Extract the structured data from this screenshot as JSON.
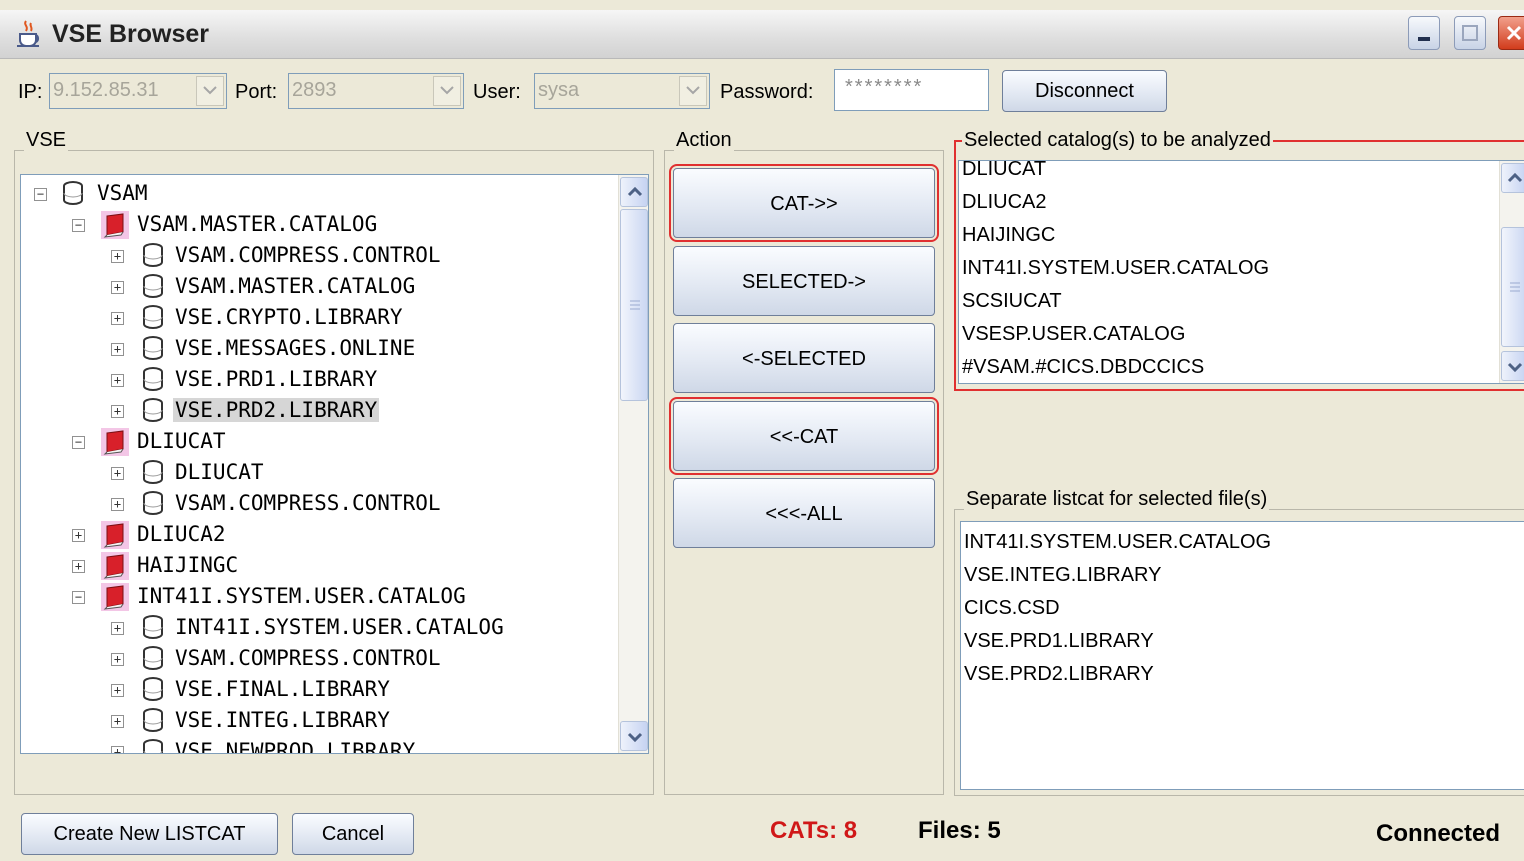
{
  "window": {
    "title": "VSE Browser"
  },
  "connection": {
    "ip_label": "IP:",
    "ip_value": "9.152.85.31",
    "port_label": "Port:",
    "port_value": "2893",
    "user_label": "User:",
    "user_value": "sysa",
    "password_label": "Password:",
    "password_value": "********",
    "disconnect_label": "Disconnect"
  },
  "vse": {
    "title": "VSE",
    "tree": [
      {
        "label": "VSAM",
        "level": 0,
        "expander": "−",
        "icon": "database-icon"
      },
      {
        "label": "VSAM.MASTER.CATALOG",
        "level": 1,
        "expander": "−",
        "icon": "catalog-book-icon"
      },
      {
        "label": "VSAM.COMPRESS.CONTROL",
        "level": 2,
        "expander": "+",
        "icon": "database-icon"
      },
      {
        "label": "VSAM.MASTER.CATALOG",
        "level": 2,
        "expander": "+",
        "icon": "database-icon"
      },
      {
        "label": "VSE.CRYPTO.LIBRARY",
        "level": 2,
        "expander": "+",
        "icon": "database-icon"
      },
      {
        "label": "VSE.MESSAGES.ONLINE",
        "level": 2,
        "expander": "+",
        "icon": "database-icon"
      },
      {
        "label": "VSE.PRD1.LIBRARY",
        "level": 2,
        "expander": "+",
        "icon": "database-icon"
      },
      {
        "label": "VSE.PRD2.LIBRARY",
        "level": 2,
        "expander": "+",
        "icon": "database-icon",
        "selected": true
      },
      {
        "label": "DLIUCAT",
        "level": 1,
        "expander": "−",
        "icon": "catalog-book-icon"
      },
      {
        "label": "DLIUCAT",
        "level": 2,
        "expander": "+",
        "icon": "database-icon"
      },
      {
        "label": "VSAM.COMPRESS.CONTROL",
        "level": 2,
        "expander": "+",
        "icon": "database-icon"
      },
      {
        "label": "DLIUCA2",
        "level": 1,
        "expander": "+",
        "icon": "catalog-book-icon"
      },
      {
        "label": "HAIJINGC",
        "level": 1,
        "expander": "+",
        "icon": "catalog-book-icon"
      },
      {
        "label": "INT41I.SYSTEM.USER.CATALOG",
        "level": 1,
        "expander": "−",
        "icon": "catalog-book-icon"
      },
      {
        "label": "INT41I.SYSTEM.USER.CATALOG",
        "level": 2,
        "expander": "+",
        "icon": "database-icon"
      },
      {
        "label": "VSAM.COMPRESS.CONTROL",
        "level": 2,
        "expander": "+",
        "icon": "database-icon"
      },
      {
        "label": "VSE.FINAL.LIBRARY",
        "level": 2,
        "expander": "+",
        "icon": "database-icon"
      },
      {
        "label": "VSE.INTEG.LIBRARY",
        "level": 2,
        "expander": "+",
        "icon": "database-icon"
      },
      {
        "label": "VSE.NEWPROD.LIBRARY",
        "level": 2,
        "expander": "+",
        "icon": "database-icon"
      }
    ]
  },
  "action": {
    "title": "Action",
    "buttons": [
      {
        "label": "CAT->>",
        "highlighted": true
      },
      {
        "label": "SELECTED->",
        "highlighted": false
      },
      {
        "label": "<-SELECTED",
        "highlighted": false
      },
      {
        "label": "<<-CAT",
        "highlighted": true
      },
      {
        "label": "<<<-ALL",
        "highlighted": false
      }
    ]
  },
  "selected_catalogs": {
    "title": "Selected catalog(s) to be analyzed",
    "items": [
      "DLIUCAT",
      "DLIUCA2",
      "HAIJINGC",
      "INT41I.SYSTEM.USER.CATALOG",
      "SCSIUCAT",
      "VSESP.USER.CATALOG",
      "#VSAM.#CICS.DBDCCICS"
    ]
  },
  "separate_listcat": {
    "title": "Separate listcat for selected file(s)",
    "items": [
      "INT41I.SYSTEM.USER.CATALOG",
      "VSE.INTEG.LIBRARY",
      "CICS.CSD",
      "VSE.PRD1.LIBRARY",
      "VSE.PRD2.LIBRARY"
    ]
  },
  "footer": {
    "create_label": "Create New LISTCAT",
    "cancel_label": "Cancel",
    "cats_status": "CATs: 8",
    "files_status": "Files: 5",
    "connection_status": "Connected"
  },
  "colors": {
    "highlight_red": "#e03030",
    "cats_red": "#d01818",
    "catalog_icon_red": "#d8202a"
  }
}
